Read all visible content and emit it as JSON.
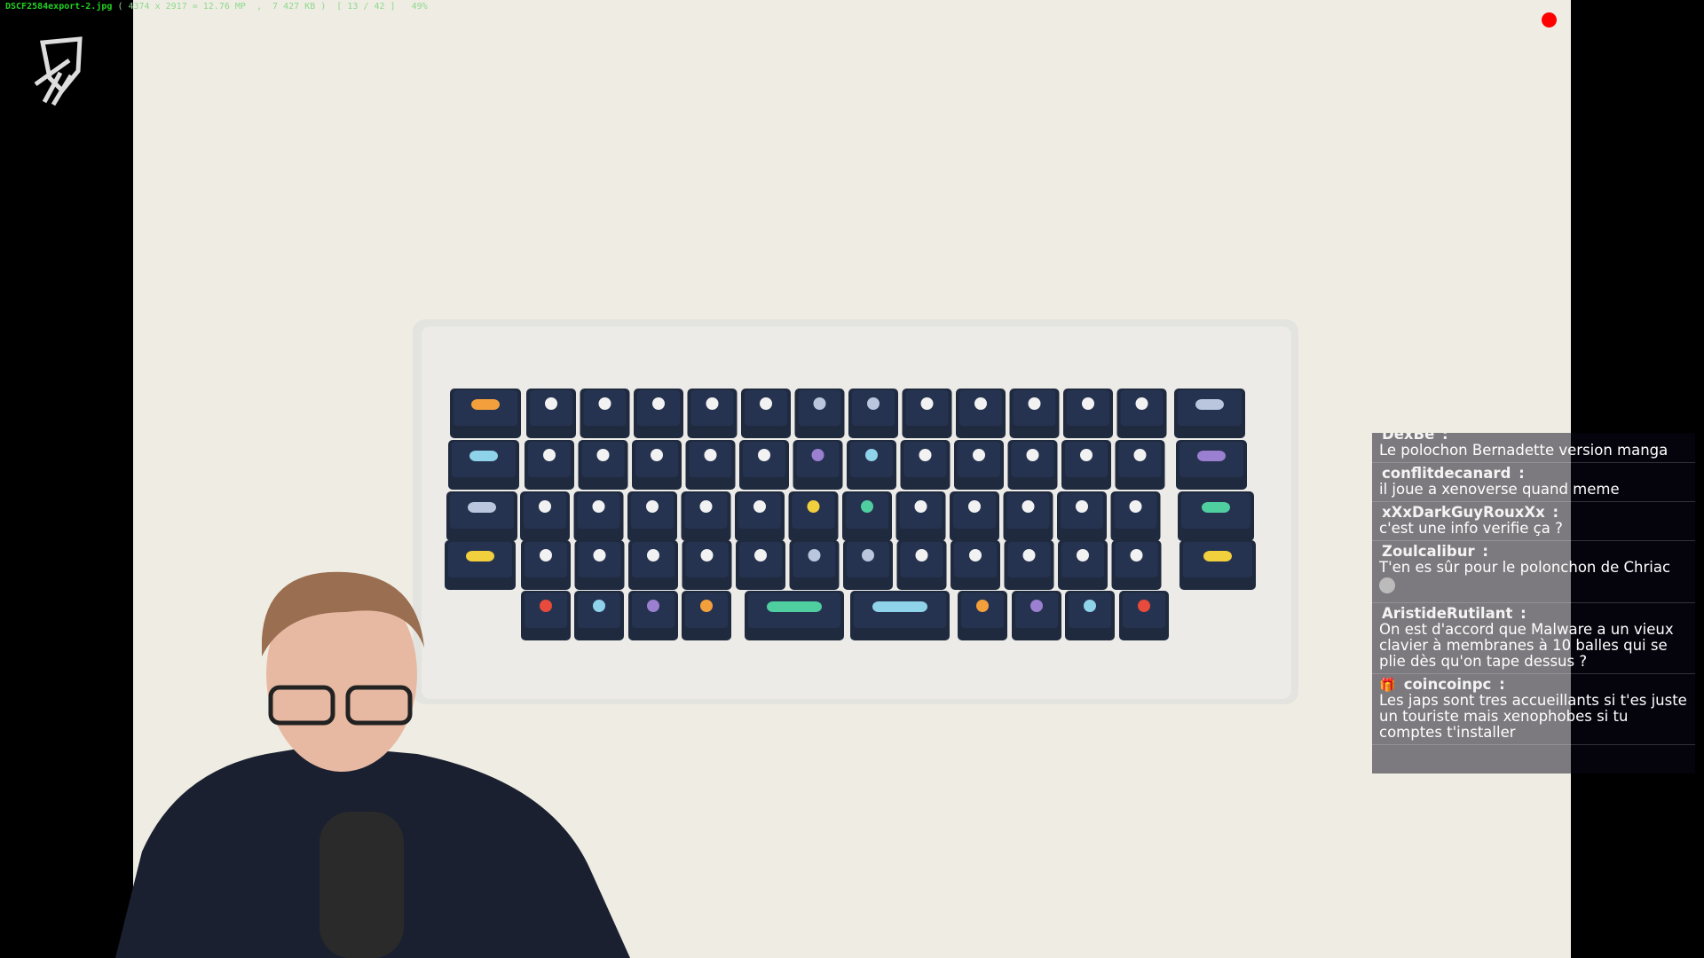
{
  "viewer": {
    "filename": "DSCF2584export-2.jpg",
    "info": "( 4374 x 2917 = 12.76 MP  ,  7 427 KB )  [ 13 / 42 ]   49%"
  },
  "recording_indicator_color": "#ff0000",
  "keyboard": {
    "rows": [
      [
        "orange",
        "white",
        "white",
        "white",
        "white",
        "white",
        "slate",
        "slate",
        "white",
        "white",
        "white",
        "white",
        "white",
        "slate"
      ],
      [
        "cyan",
        "white",
        "white",
        "white",
        "white",
        "white",
        "purple",
        "cyan",
        "white",
        "white",
        "white",
        "white",
        "white",
        "purple"
      ],
      [
        "slate",
        "white",
        "white",
        "white",
        "white",
        "white",
        "yellow",
        "green",
        "white",
        "white",
        "white",
        "white",
        "white",
        "green"
      ],
      [
        "yellow",
        "white",
        "white",
        "white",
        "white",
        "white",
        "slate",
        "slate",
        "white",
        "white",
        "white",
        "white",
        "white",
        "yellow"
      ],
      [
        "red",
        "cyan",
        "purple",
        "orange",
        "green",
        "cyan",
        "orange",
        "purple",
        "cyan",
        "red"
      ]
    ],
    "colors": {
      "orange": "#f3a03c",
      "white": "#f2f2f2",
      "slate": "#b9c6dd",
      "cyan": "#8fd3ea",
      "purple": "#9b7fd0",
      "yellow": "#f1cf3d",
      "green": "#4fcfa0",
      "red": "#e84a3b"
    }
  },
  "chat": {
    "messages": [
      {
        "user": "DexBe",
        "text": "Le polochon Bernadette version manga"
      },
      {
        "user": "conflitdecanard",
        "text": "il joue a xenoverse quand meme"
      },
      {
        "user": "xXxDarkGuyRouxXx",
        "text": "c'est une info verifie ça ?"
      },
      {
        "user": "Zoulcalibur",
        "text": "T'en es sûr pour le polonchon de Chriac",
        "emote": "face-emote"
      },
      {
        "user": "AristideRutilant",
        "text": "On est d'accord que Malware a un vieux clavier à membranes à 10 balles qui se plie dès qu'on tape dessus ?"
      },
      {
        "user": "coincoinpc",
        "text": "Les japs sont tres accueillants si t'es juste un touriste mais xenophobes si tu comptes t'installer",
        "badge": "gift-icon"
      }
    ]
  }
}
